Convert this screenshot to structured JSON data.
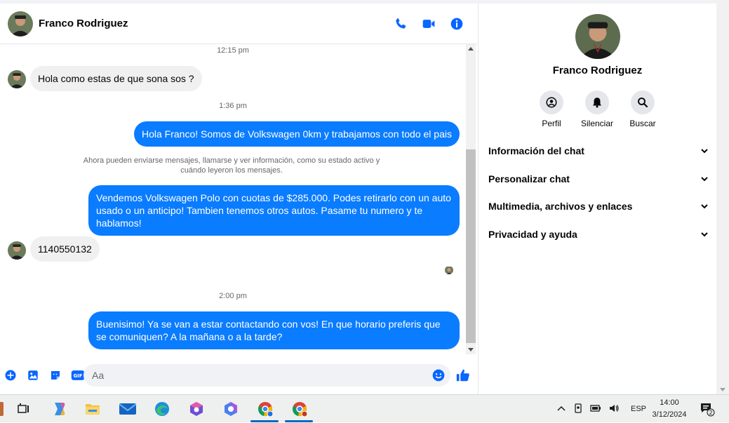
{
  "contact": {
    "name": "Franco Rodriguez"
  },
  "conversation": {
    "timestamps": [
      "12:15 pm",
      "1:36 pm",
      "2:00 pm"
    ],
    "messages": [
      {
        "from": "contact",
        "text": "Hola como estas de que sona sos ?"
      },
      {
        "from": "me",
        "text": "Hola Franco! Somos de Volkswagen 0km y trabajamos con todo el pais"
      },
      {
        "from": "me",
        "text": "Vendemos  Volkswagen Polo con cuotas de $285.000. Podes retirarlo con un auto usado o un anticipo! Tambien tenemos otros autos. Pasame tu numero y te hablamos!"
      },
      {
        "from": "contact",
        "text": "1140550132"
      },
      {
        "from": "me",
        "text": "Buenisimo! Ya se van a estar contactando con vos! En que horario preferis que se comuniquen? A la mañana o a la tarde?"
      }
    ],
    "system_note": "Ahora pueden enviarse mensajes, llamarse y ver información, como su estado activo y cuándo leyeron los mensajes."
  },
  "composer": {
    "placeholder": "Aa"
  },
  "info_panel": {
    "actions": [
      {
        "label": "Perfil",
        "icon": "profile-icon"
      },
      {
        "label": "Silenciar",
        "icon": "bell-icon"
      },
      {
        "label": "Buscar",
        "icon": "search-icon"
      }
    ],
    "sections": [
      "Información del chat",
      "Personalizar chat",
      "Multimedia, archivos y enlaces",
      "Privacidad y ayuda"
    ]
  },
  "taskbar": {
    "language": "ESP",
    "time": "14:00",
    "date": "3/12/2024",
    "notification_count": "2",
    "apps": [
      "task-view-icon",
      "copilot-icon",
      "file-explorer-icon",
      "mail-icon",
      "edge-icon",
      "m365-icon",
      "copilot-app-icon",
      "chrome-profile-icon",
      "chrome-b-icon"
    ]
  },
  "colors": {
    "accent": "#0a7cff",
    "icon_blue": "#0866ff",
    "bubble_in": "#f0f0f0"
  }
}
